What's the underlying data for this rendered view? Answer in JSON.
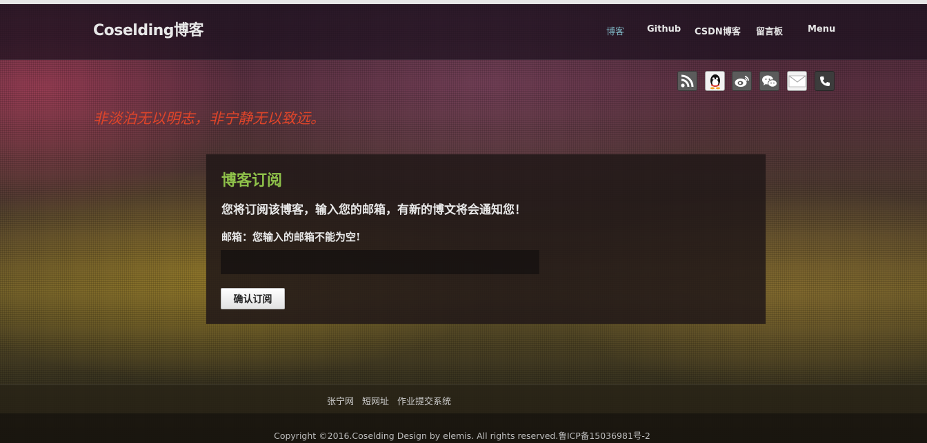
{
  "header": {
    "brand": "Coselding博客",
    "nav": [
      {
        "label": "博客",
        "active": true
      },
      {
        "label": "Github",
        "active": false
      },
      {
        "label": "CSDN博客",
        "active": false
      },
      {
        "label": "留言板",
        "active": false
      },
      {
        "label": "Menu",
        "active": false
      }
    ]
  },
  "social_icons": [
    "rss-icon",
    "qq-icon",
    "weibo-icon",
    "wechat-icon",
    "email-icon",
    "phone-icon"
  ],
  "motto": "非淡泊无以明志，非宁静无以致远。",
  "subscribe": {
    "title": "博客订阅",
    "description": "您将订阅该博客，输入您的邮箱，有新的博文将会通知您！",
    "email_label": "邮箱：您输入的邮箱不能为空!",
    "email_value": "",
    "button_label": "确认订阅"
  },
  "footer": {
    "links": [
      "张宁网",
      "短网址",
      "作业提交系统"
    ],
    "copyright": "Copyright ©2016.Coselding  Design by elemis. All rights reserved.鲁ICP备15036981号-2"
  },
  "colors": {
    "accent_nav": "#7fb6c4",
    "motto": "#e0452a",
    "panel_title": "#8fc24a"
  }
}
